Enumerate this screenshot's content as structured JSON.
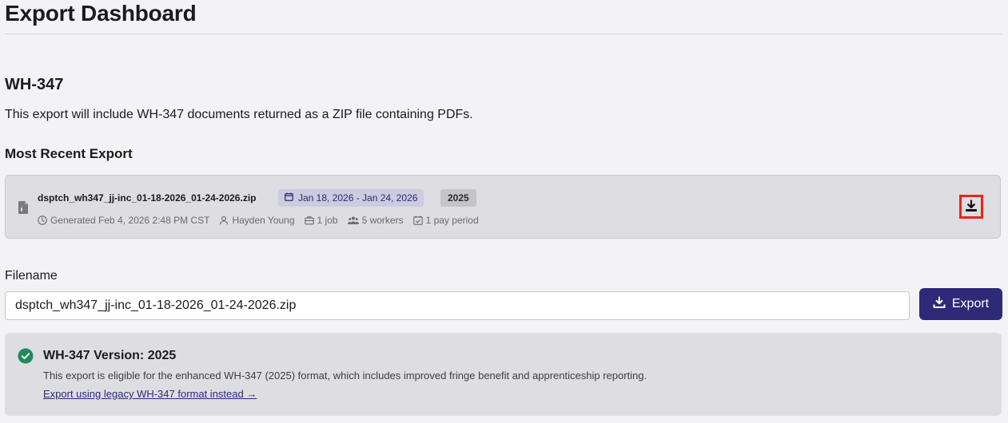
{
  "page": {
    "title": "Export Dashboard"
  },
  "section": {
    "title": "WH-347",
    "description": "This export will include WH-347 documents returned as a ZIP file containing PDFs."
  },
  "recent_export": {
    "heading": "Most Recent Export",
    "file_name": "dsptch_wh347_jj-inc_01-18-2026_01-24-2026.zip",
    "date_range": "Jan 18, 2026 - Jan 24, 2026",
    "year": "2025",
    "generated": "Generated Feb 4, 2026 2:48 PM CST",
    "user": "Hayden Young",
    "jobs": "1 job",
    "workers": "5 workers",
    "pay_periods": "1 pay period",
    "icons": [
      "file-icon",
      "calendar-icon",
      "clock-icon",
      "user-icon",
      "briefcase-icon",
      "users-icon",
      "calendar-check-icon",
      "download-icon"
    ]
  },
  "filename": {
    "label": "Filename",
    "value": "dsptch_wh347_jj-inc_01-18-2026_01-24-2026.zip"
  },
  "export_button": {
    "label": "Export",
    "icon": "download-icon"
  },
  "version": {
    "title": "WH-347 Version: 2025",
    "description": "This export is eligible for the enhanced WH-347 (2025) format, which includes improved fringe benefit and apprenticeship reporting.",
    "legacy_link": "Export using legacy WH-347 format instead →",
    "icon": "check-circle-icon"
  },
  "colors": {
    "accent": "#2e2a78",
    "success": "#1f8a5b",
    "highlight_border": "#e8261a",
    "background": "#f3f2f5",
    "card": "#dedde1"
  }
}
